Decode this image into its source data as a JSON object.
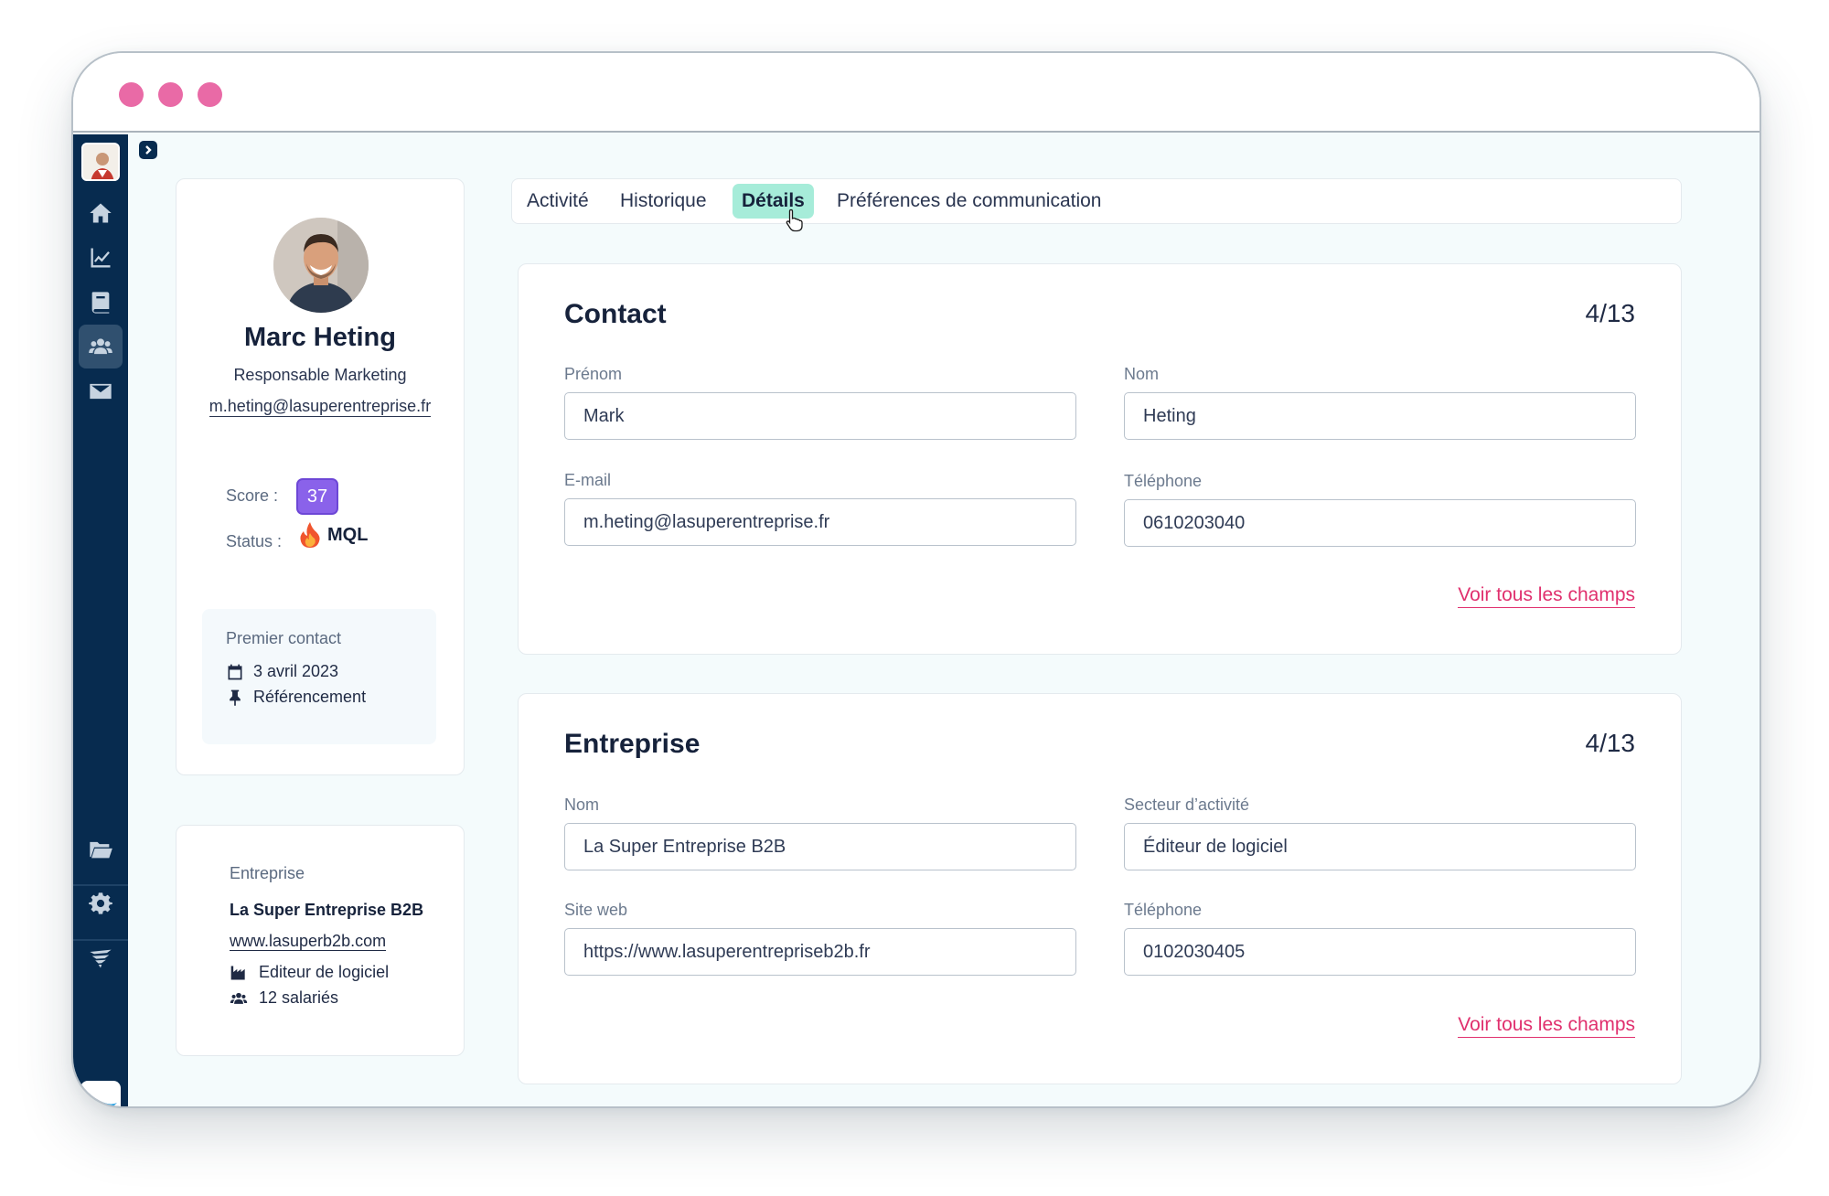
{
  "window": {
    "controls": [
      "close",
      "minimize",
      "maximize"
    ]
  },
  "sidebar": {
    "items": [
      {
        "name": "home-icon",
        "active": false
      },
      {
        "name": "chart-icon",
        "active": false
      },
      {
        "name": "book-icon",
        "active": false
      },
      {
        "name": "users-icon",
        "active": true
      },
      {
        "name": "mail-icon",
        "active": false
      },
      {
        "name": "folder-icon",
        "active": false
      },
      {
        "name": "gear-icon",
        "active": false
      },
      {
        "name": "brand-icon",
        "active": false
      }
    ]
  },
  "profile": {
    "name": "Marc Heting",
    "role": "Responsable Marketing",
    "email": "m.heting@lasuperentreprise.fr",
    "score_label": "Score :",
    "score": "37",
    "status_label": "Status :",
    "status": "MQL",
    "first_contact": {
      "title": "Premier contact",
      "date": "3 avril 2023",
      "source": "Référencement"
    }
  },
  "company_card": {
    "title": "Entreprise",
    "name": "La Super Entreprise B2B",
    "website": "www.lasuperb2b.com",
    "industry": "Editeur de logiciel",
    "employees": "12 salariés"
  },
  "tabs": [
    {
      "label": "Activité",
      "active": false
    },
    {
      "label": "Historique",
      "active": false
    },
    {
      "label": "Détails",
      "active": true
    },
    {
      "label": "Préférences de communication",
      "active": false
    }
  ],
  "contact_section": {
    "title": "Contact",
    "count": "4/13",
    "fields": {
      "first_name": {
        "label": "Prénom",
        "value": "Mark"
      },
      "last_name": {
        "label": "Nom",
        "value": "Heting"
      },
      "email": {
        "label": "E-mail",
        "value": "m.heting@lasuperentreprise.fr"
      },
      "phone": {
        "label": "Téléphone",
        "value": "0610203040"
      }
    },
    "see_all": "Voir tous les champs"
  },
  "company_section": {
    "title": "Entreprise",
    "count": "4/13",
    "fields": {
      "name": {
        "label": "Nom",
        "value": "La Super Entreprise B2B"
      },
      "sector": {
        "label": "Secteur d’activité",
        "value": "Éditeur de logiciel"
      },
      "website": {
        "label": "Site web",
        "value": "https://www.lasuperentrepriseb2b.fr"
      },
      "phone": {
        "label": "Téléphone",
        "value": "0102030405"
      }
    },
    "see_all": "Voir tous les champs"
  },
  "colors": {
    "sidebar": "#072b4f",
    "accent_pink": "#e0306e",
    "tab_active": "#a6ecd9",
    "score_badge": "#8a62ea",
    "window_dots": "#e96aa6"
  }
}
